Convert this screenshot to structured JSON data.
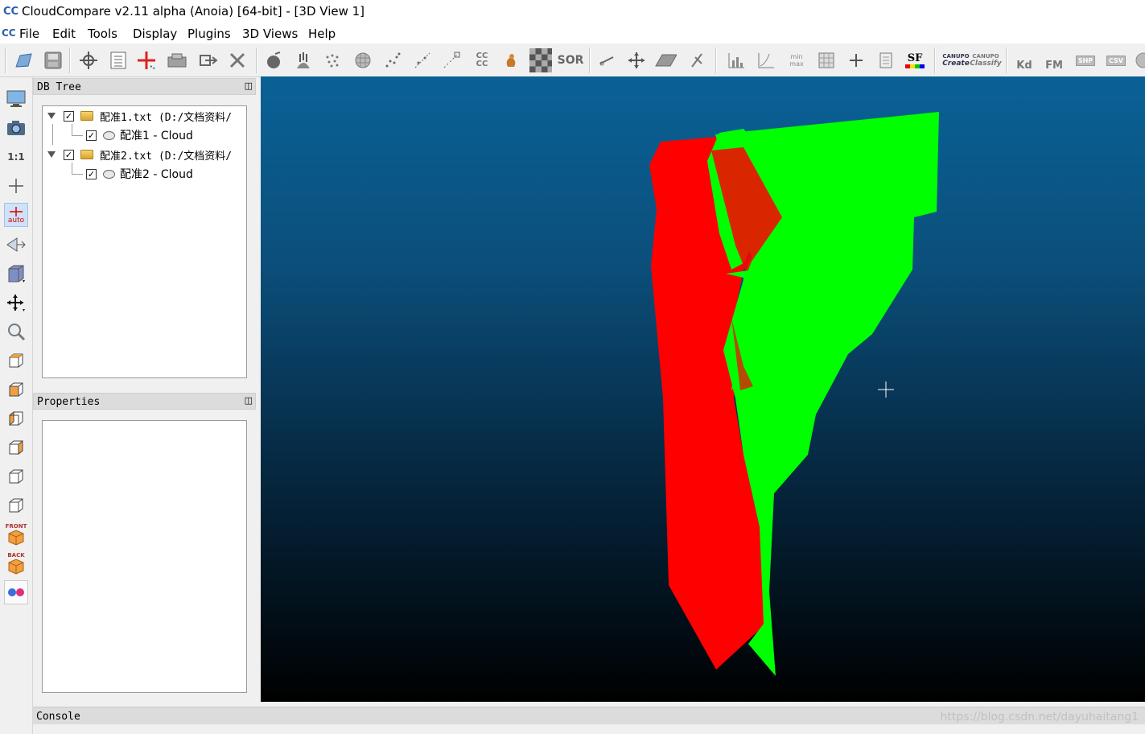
{
  "window": {
    "title": "CloudCompare v2.11 alpha (Anoia) [64-bit] - [3D View 1]",
    "app_icon": "CC"
  },
  "menu": [
    {
      "label": "File"
    },
    {
      "label": "Edit"
    },
    {
      "label": "Tools"
    },
    {
      "label": "Display"
    },
    {
      "label": "Plugins"
    },
    {
      "label": "3D Views"
    },
    {
      "label": "Help"
    }
  ],
  "toolbar": {
    "icons": [
      "open-icon",
      "save-icon",
      "pick-point-icon",
      "list-icon",
      "translate-rotate-icon",
      "clone-icon",
      "merge-icon",
      "delete-icon",
      "sample-icon",
      "normals-icon",
      "subsample-icon",
      "mesh-icon",
      "scatter-icon",
      "scatter-2-icon",
      "scatter-3-icon",
      "compare-icon",
      "primitive-icon",
      "checker-icon",
      "sor-icon",
      "segment-icon",
      "move-icon",
      "plane-icon",
      "measure-icon",
      "histogram-icon",
      "curve-icon",
      "minmax-icon",
      "calc-icon",
      "plus-icon",
      "grid-icon",
      "sf-icon",
      "canupo-create-icon",
      "canupo-classify-icon",
      "kd-icon",
      "fm-icon",
      "shp-icon",
      "csv-icon",
      "extra-icon"
    ],
    "labels": {
      "cc": "CC\nCC",
      "sor": "SOR",
      "sf": "SF",
      "canupo_create_top": "CANUPO",
      "canupo_create": "Create",
      "canupo_classify_top": "CANUPO",
      "canupo_classify": "Classify",
      "kd": "Kd",
      "fm": "FM",
      "shp": "SHP",
      "csv": "CSV",
      "min": "min",
      "max": "max"
    }
  },
  "left_toolbar": {
    "one_to_one": "1:1",
    "auto": "auto",
    "front": "FRONT",
    "back": "BACK"
  },
  "db_tree": {
    "title": "DB Tree",
    "items": [
      {
        "label": "配准1.txt (D:/文档资料/",
        "checked": true,
        "level": 0,
        "type": "folder"
      },
      {
        "label": "配准1 - Cloud",
        "checked": true,
        "level": 1,
        "type": "cloud"
      },
      {
        "label": "配准2.txt (D:/文档资料/",
        "checked": true,
        "level": 0,
        "type": "folder"
      },
      {
        "label": "配准2 - Cloud",
        "checked": true,
        "level": 1,
        "type": "cloud"
      }
    ]
  },
  "properties": {
    "title": "Properties"
  },
  "console": {
    "title": "Console"
  },
  "viewport": {
    "name": "3D View 1",
    "colors": {
      "cloud1": "#ff0000",
      "cloud2": "#00ff00",
      "bg_top": "#0a6196",
      "bg_bottom": "#000000"
    }
  },
  "watermark": "https://blog.csdn.net/dayuhaitang1"
}
